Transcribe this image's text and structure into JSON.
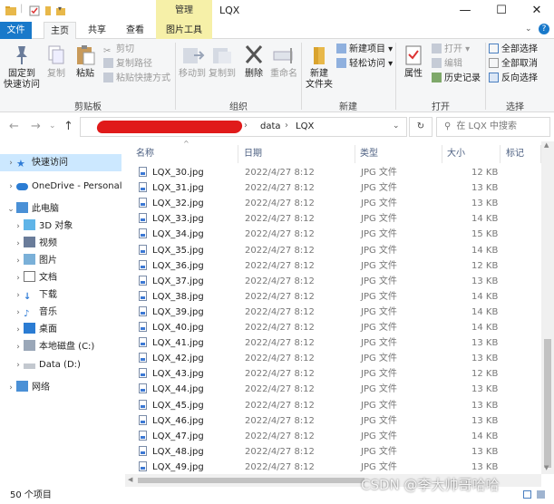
{
  "titlebar": {
    "manage_label": "管理",
    "window_title": "LQX",
    "controls": [
      "—",
      "☐",
      "✕"
    ]
  },
  "tabs": {
    "file": "文件",
    "home": "主页",
    "share": "共享",
    "view": "查看",
    "picture_tools": "图片工具"
  },
  "ribbon": {
    "pin_quick_access": "固定到\n快速访问",
    "copy": "复制",
    "paste": "粘贴",
    "cut": "剪切",
    "copy_path": "复制路径",
    "paste_shortcut": "粘贴快捷方式",
    "clipboard_group": "剪贴板",
    "move_to": "移动到",
    "copy_to": "复制到",
    "delete": "删除",
    "rename": "重命名",
    "organize_group": "组织",
    "new_folder": "新建\n文件夹",
    "new_item": "新建项目",
    "easy_access": "轻松访问",
    "new_group": "新建",
    "properties": "属性",
    "open": "打开",
    "edit": "编辑",
    "history": "历史记录",
    "open_group": "打开",
    "select_all": "全部选择",
    "select_none": "全部取消",
    "invert_selection": "反向选择",
    "select_group": "选择"
  },
  "address": {
    "path": [
      "data",
      "LQX"
    ],
    "search_placeholder": "在 LQX 中搜索"
  },
  "navpane": {
    "quick_access": "快速访问",
    "onedrive": "OneDrive - Personal",
    "this_pc": "此电脑",
    "objects_3d": "3D 对象",
    "videos": "视频",
    "pictures": "图片",
    "documents": "文档",
    "downloads": "下载",
    "music": "音乐",
    "desktop": "桌面",
    "local_disk": "本地磁盘 (C:)",
    "data_disk": "Data (D:)",
    "network": "网络"
  },
  "columns": {
    "name": "名称",
    "date": "日期",
    "type": "类型",
    "size": "大小",
    "tags": "标记"
  },
  "files": [
    {
      "name": "LQX_30.jpg",
      "date": "2022/4/27 8:12",
      "type": "JPG 文件",
      "size": "12 KB"
    },
    {
      "name": "LQX_31.jpg",
      "date": "2022/4/27 8:12",
      "type": "JPG 文件",
      "size": "13 KB"
    },
    {
      "name": "LQX_32.jpg",
      "date": "2022/4/27 8:12",
      "type": "JPG 文件",
      "size": "13 KB"
    },
    {
      "name": "LQX_33.jpg",
      "date": "2022/4/27 8:12",
      "type": "JPG 文件",
      "size": "14 KB"
    },
    {
      "name": "LQX_34.jpg",
      "date": "2022/4/27 8:12",
      "type": "JPG 文件",
      "size": "15 KB"
    },
    {
      "name": "LQX_35.jpg",
      "date": "2022/4/27 8:12",
      "type": "JPG 文件",
      "size": "14 KB"
    },
    {
      "name": "LQX_36.jpg",
      "date": "2022/4/27 8:12",
      "type": "JPG 文件",
      "size": "12 KB"
    },
    {
      "name": "LQX_37.jpg",
      "date": "2022/4/27 8:12",
      "type": "JPG 文件",
      "size": "13 KB"
    },
    {
      "name": "LQX_38.jpg",
      "date": "2022/4/27 8:12",
      "type": "JPG 文件",
      "size": "14 KB"
    },
    {
      "name": "LQX_39.jpg",
      "date": "2022/4/27 8:12",
      "type": "JPG 文件",
      "size": "14 KB"
    },
    {
      "name": "LQX_40.jpg",
      "date": "2022/4/27 8:12",
      "type": "JPG 文件",
      "size": "14 KB"
    },
    {
      "name": "LQX_41.jpg",
      "date": "2022/4/27 8:12",
      "type": "JPG 文件",
      "size": "13 KB"
    },
    {
      "name": "LQX_42.jpg",
      "date": "2022/4/27 8:12",
      "type": "JPG 文件",
      "size": "13 KB"
    },
    {
      "name": "LQX_43.jpg",
      "date": "2022/4/27 8:12",
      "type": "JPG 文件",
      "size": "12 KB"
    },
    {
      "name": "LQX_44.jpg",
      "date": "2022/4/27 8:12",
      "type": "JPG 文件",
      "size": "13 KB"
    },
    {
      "name": "LQX_45.jpg",
      "date": "2022/4/27 8:12",
      "type": "JPG 文件",
      "size": "13 KB"
    },
    {
      "name": "LQX_46.jpg",
      "date": "2022/4/27 8:12",
      "type": "JPG 文件",
      "size": "13 KB"
    },
    {
      "name": "LQX_47.jpg",
      "date": "2022/4/27 8:12",
      "type": "JPG 文件",
      "size": "14 KB"
    },
    {
      "name": "LQX_48.jpg",
      "date": "2022/4/27 8:12",
      "type": "JPG 文件",
      "size": "13 KB"
    },
    {
      "name": "LQX_49.jpg",
      "date": "2022/4/27 8:12",
      "type": "JPG 文件",
      "size": "13 KB"
    }
  ],
  "status": {
    "item_count": "50 个项目"
  },
  "watermark": "CSDN @李大帅哥哈哈",
  "colors": {
    "file_tab": "#1979ca",
    "picture_tools": "#f6f0a8",
    "selected_nav": "#cce8ff",
    "redaction": "#e01a1a"
  }
}
